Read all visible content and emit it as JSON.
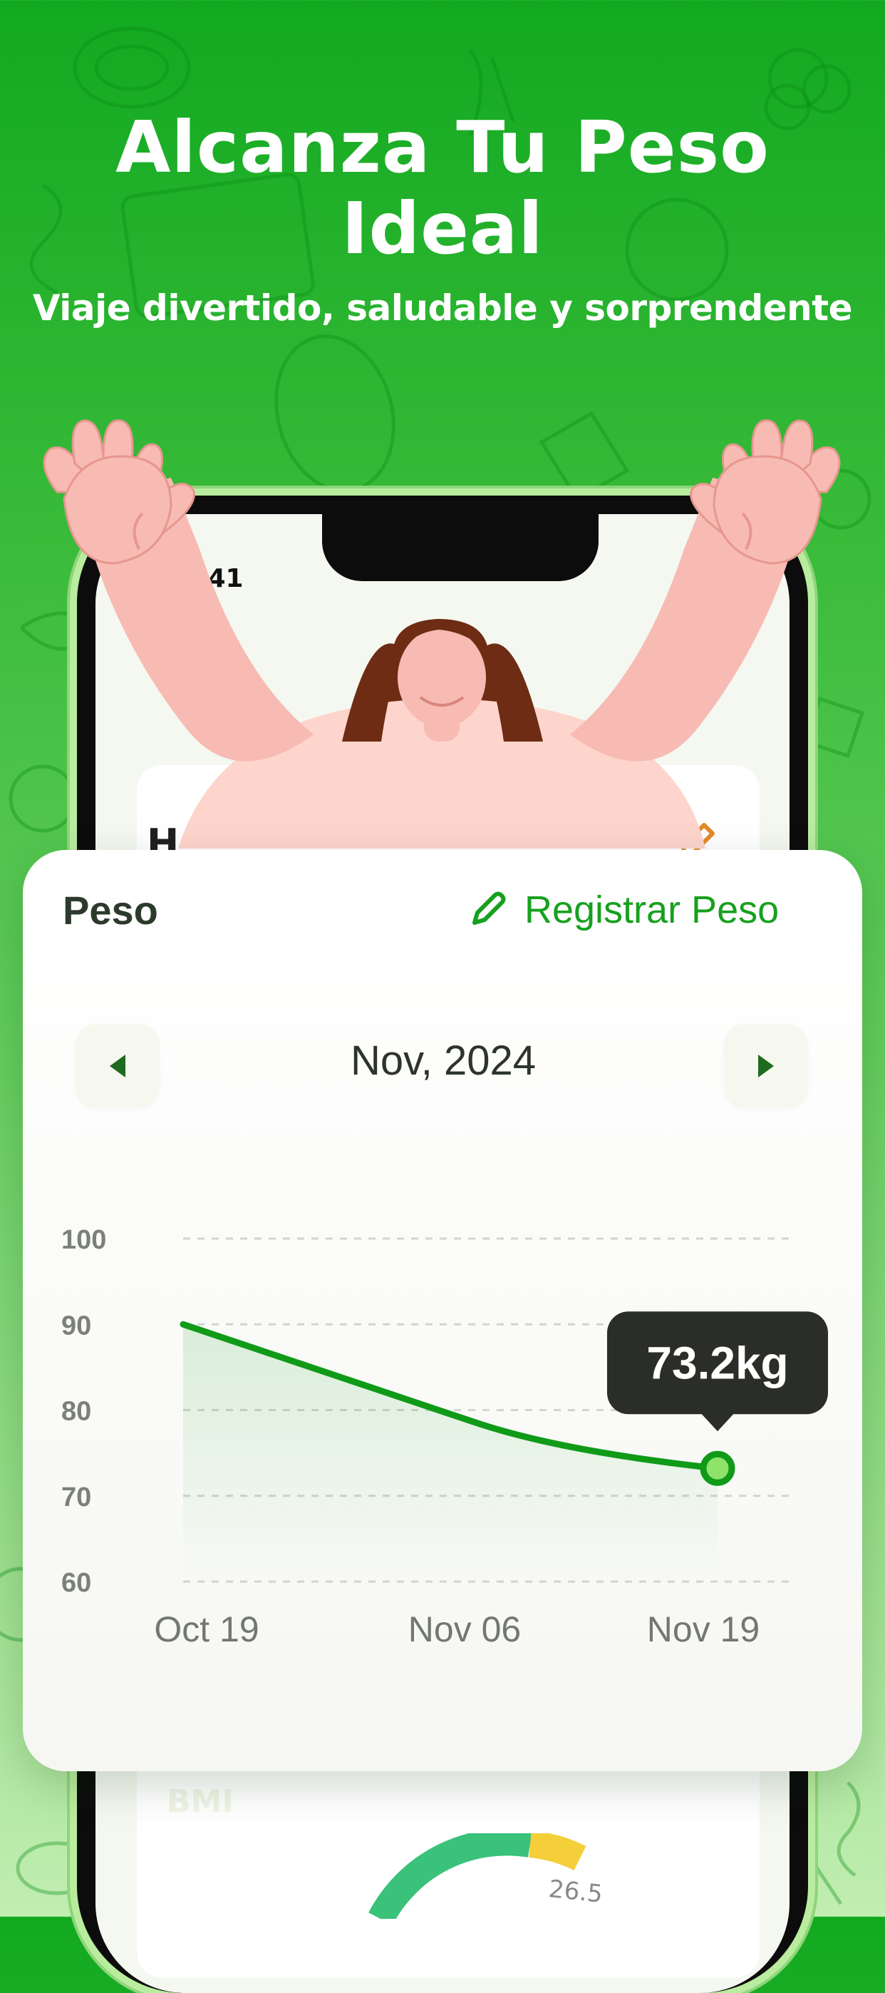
{
  "header": {
    "title": "Alcanza Tu Peso Ideal",
    "subtitle": "Viaje divertido, saludable y sorprendente"
  },
  "phone": {
    "status_time": "9:41",
    "status_icons": [
      "cellular-signal-icon",
      "wifi-icon",
      "battery-icon"
    ],
    "inner_title": "H",
    "bmi_label": "BMI",
    "bmi_gauge_value": "26.5"
  },
  "weight_card": {
    "title": "Peso",
    "register_label": "Registrar Peso",
    "month_label": "Nov, 2024",
    "tooltip_value": "73.2kg"
  },
  "colors": {
    "brand_green": "#17a01f",
    "line_green": "#109a18",
    "tooltip_bg": "#2b2e28",
    "point_fill": "#8fe36b"
  },
  "chart_data": {
    "type": "line",
    "x": [
      "Oct 19",
      "Nov 06",
      "Nov 19"
    ],
    "y_ticks": [
      100,
      90,
      80,
      70,
      60
    ],
    "ylim": [
      60,
      100
    ],
    "series": [
      {
        "values": [
          90,
          78.5,
          73.2
        ]
      }
    ],
    "annotations": [
      "73.2kg"
    ],
    "grid": true
  }
}
